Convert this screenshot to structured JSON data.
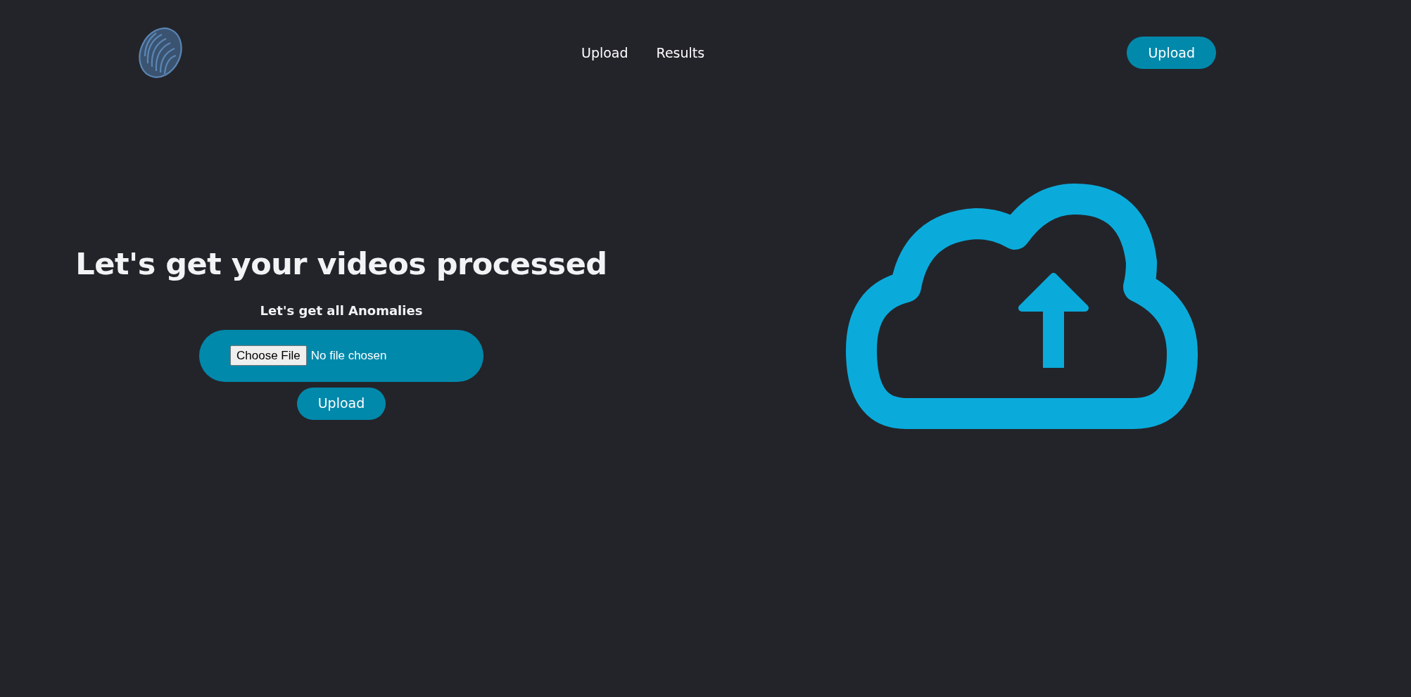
{
  "nav": {
    "links": [
      {
        "label": "Upload"
      },
      {
        "label": "Results"
      }
    ],
    "button": "Upload"
  },
  "hero": {
    "title": "Let's get your videos processed",
    "subtitle": "Let's get all Anomalies",
    "file_input": {
      "button": "Choose File",
      "status": "No file chosen"
    },
    "upload_button": "Upload"
  }
}
